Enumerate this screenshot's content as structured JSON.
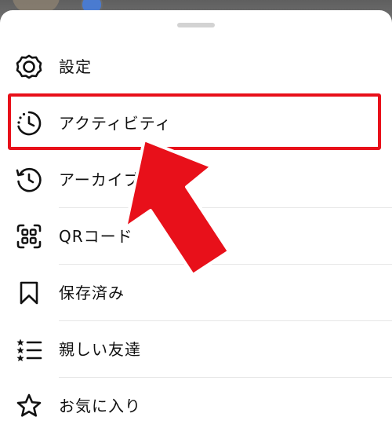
{
  "menu": {
    "items": [
      {
        "label": "設定",
        "icon": "gear-icon"
      },
      {
        "label": "アクティビティ",
        "icon": "activity-clock-icon"
      },
      {
        "label": "アーカイブ",
        "icon": "archive-history-icon"
      },
      {
        "label": "QRコード",
        "icon": "qr-code-icon"
      },
      {
        "label": "保存済み",
        "icon": "bookmark-icon"
      },
      {
        "label": "親しい友達",
        "icon": "close-friends-list-icon"
      },
      {
        "label": "お気に入り",
        "icon": "star-icon"
      }
    ]
  },
  "annotation": {
    "highlight_color": "#e8101a",
    "highlighted_item": "アクティビティ"
  }
}
